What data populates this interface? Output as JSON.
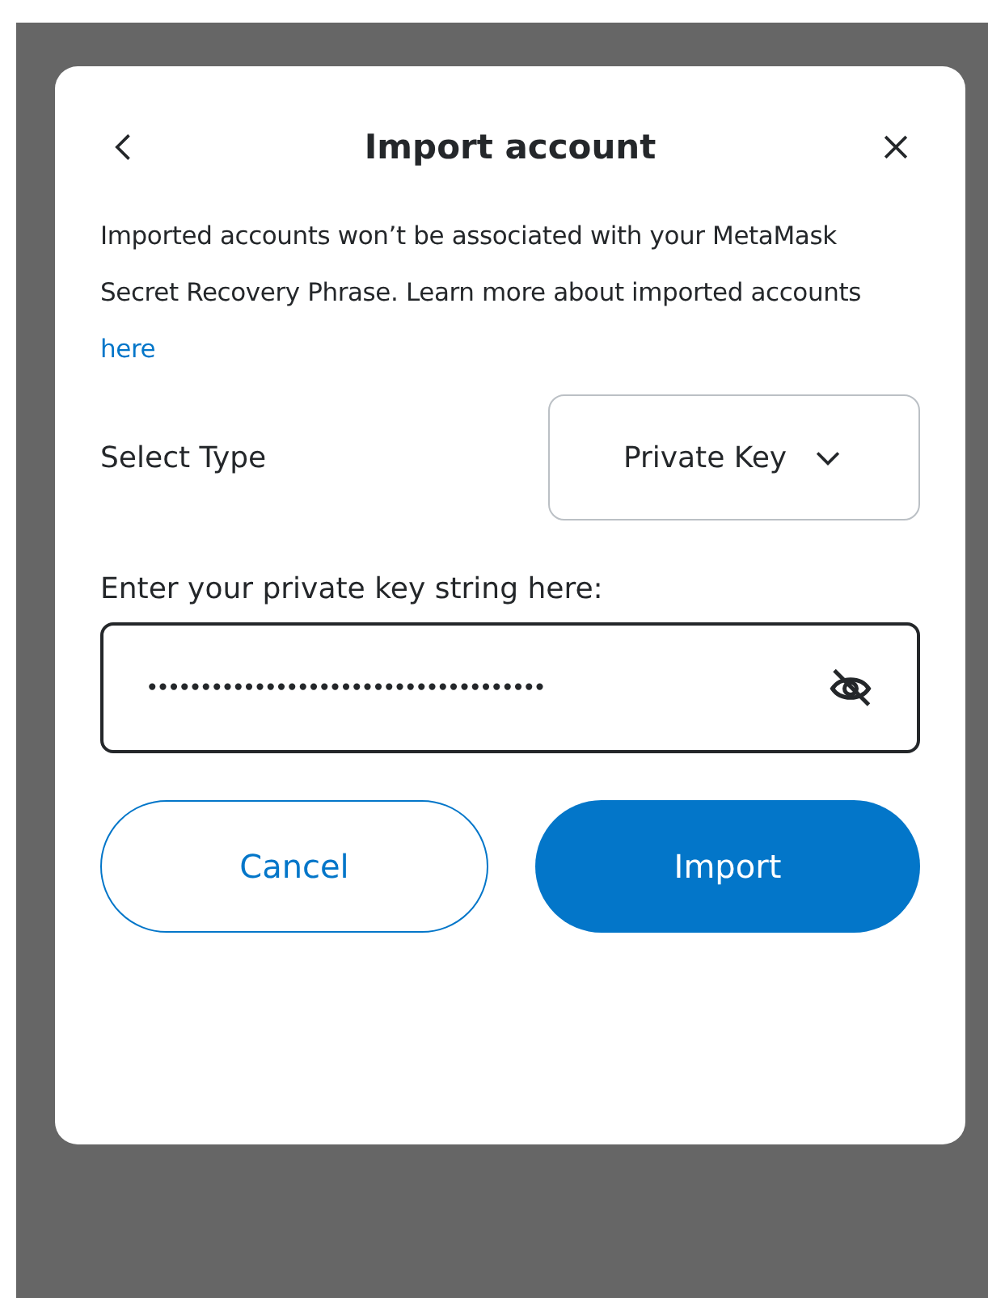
{
  "dialog": {
    "title": "Import account",
    "notice": "Imported accounts won’t be associated with your MetaMask Secret Recovery Phrase. Learn more about imported accounts",
    "notice_link": "here",
    "select_type": {
      "label": "Select Type",
      "value": "Private Key"
    },
    "key_field": {
      "label": "Enter your private key string here:",
      "value": "•••••••••••••••••••••••••••••••••••••",
      "hidden": true
    },
    "buttons": [
      {
        "label": "Cancel",
        "kind": "secondary"
      },
      {
        "label": "Import",
        "kind": "primary"
      }
    ]
  }
}
